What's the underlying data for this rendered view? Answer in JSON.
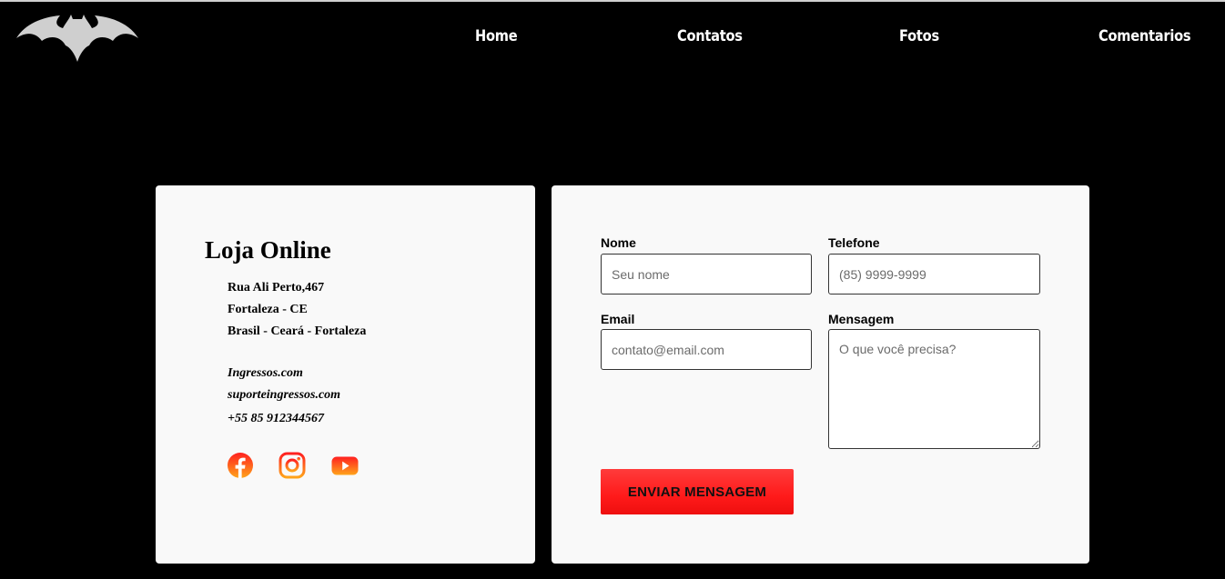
{
  "nav": {
    "logo_icon": "bat-logo-icon",
    "links": [
      "Home",
      "Contatos",
      "Fotos",
      "Comentarios"
    ]
  },
  "info": {
    "title": "Loja Online",
    "address": [
      "Rua Ali Perto,467",
      "Fortaleza - CE",
      "Brasil - Ceará - Fortaleza"
    ],
    "contacts": [
      "Ingressos.com",
      "suporteingressos.com",
      "+55 85 912344567"
    ],
    "social_icons": [
      "facebook-icon",
      "instagram-icon",
      "youtube-icon"
    ]
  },
  "form": {
    "nome_label": "Nome",
    "nome_placeholder": "Seu nome",
    "telefone_label": "Telefone",
    "telefone_placeholder": "(85) 9999-9999",
    "email_label": "Email",
    "email_placeholder": "contato@email.com",
    "mensagem_label": "Mensagem",
    "mensagem_placeholder": "O que você precisa?",
    "submit_label": "ENVIAR MENSAGEM"
  },
  "colors": {
    "background": "#000000",
    "card": "#f9f9f9",
    "button": "#ff1f1f",
    "social_gradient": [
      "#ff2020",
      "#ffa41b"
    ]
  }
}
